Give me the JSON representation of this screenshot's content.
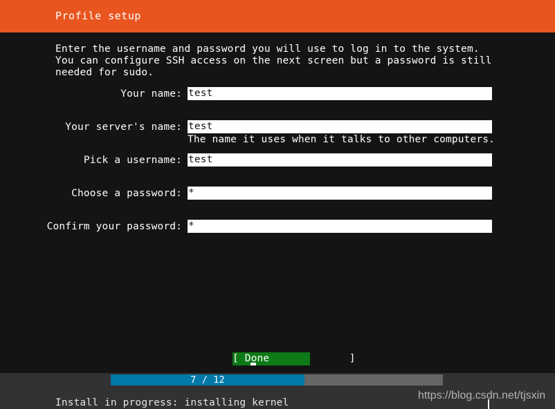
{
  "colors": {
    "header_bg": "#e8551f",
    "screen_bg": "#141414",
    "input_bg": "#ffffff",
    "input_fg": "#141414",
    "done_bg": "#0e7a17",
    "progress_fill": "#0079a8",
    "progress_track": "#666666",
    "bottom_bar": "#323232",
    "text": "#ffffff"
  },
  "header": {
    "title": "Profile setup"
  },
  "intro": {
    "text": "Enter the username and password you will use to log in to the system. You can configure SSH access on the next screen but a password is still needed for sudo."
  },
  "form": {
    "fields": [
      {
        "label": "Your name:",
        "value": "test",
        "placeholder": "",
        "hint": ""
      },
      {
        "label": "Your server's name:",
        "value": "test",
        "placeholder": "",
        "hint": "The name it uses when it talks to other computers."
      },
      {
        "label": "Pick a username:",
        "value": "test",
        "placeholder": "",
        "hint": ""
      },
      {
        "label": "Choose a password:",
        "value": "*",
        "placeholder": "",
        "hint": ""
      },
      {
        "label": "Confirm your password:",
        "value": "*",
        "placeholder": "",
        "hint": ""
      }
    ]
  },
  "actions": {
    "done_label": "[ Done             ]"
  },
  "footer": {
    "progress_text": "7 / 12",
    "progress_current": 7,
    "progress_total": 12,
    "status_text": "Install in progress: installing kernel"
  },
  "watermark": {
    "text": "https://blog.csdn.net/tjsxin"
  }
}
